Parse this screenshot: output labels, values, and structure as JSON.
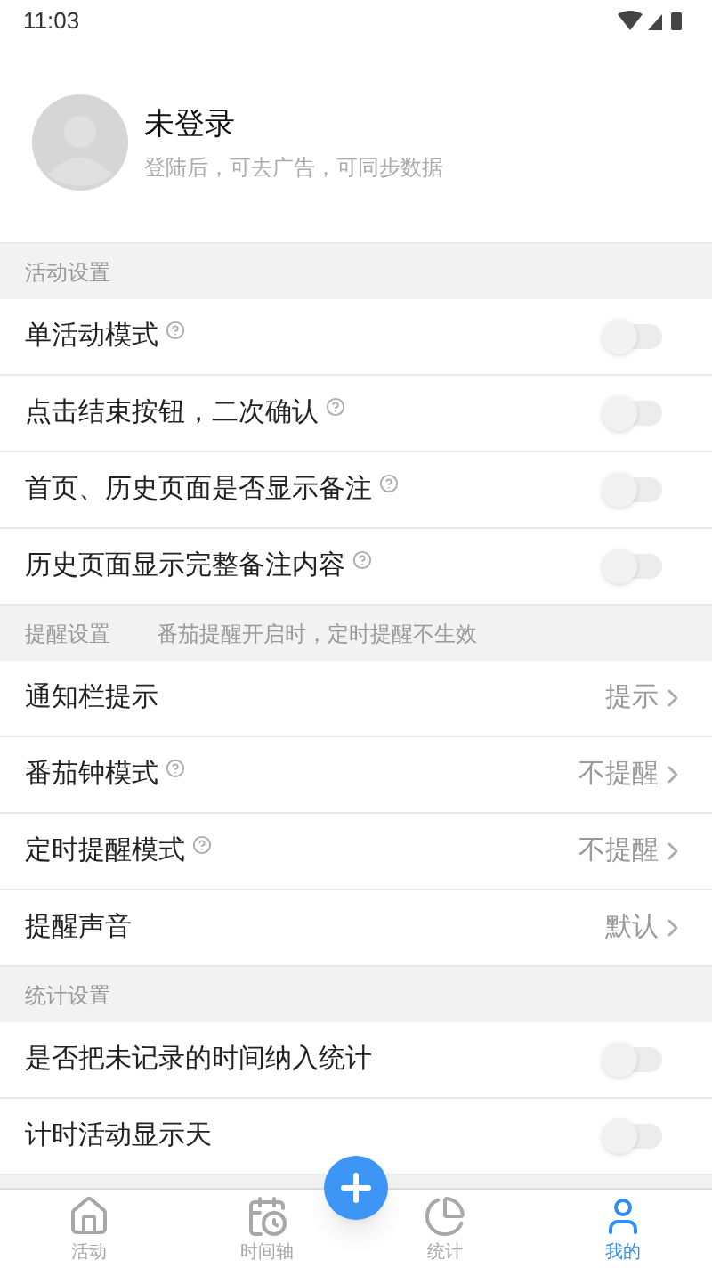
{
  "status_bar": {
    "time": "11:03"
  },
  "profile": {
    "name": "未登录",
    "subtitle": "登陆后，可去广告，可同步数据"
  },
  "sections": [
    {
      "title": "活动设置",
      "rows": [
        {
          "kind": "toggle",
          "label": "单活动模式",
          "help": true,
          "on": false
        },
        {
          "kind": "toggle",
          "label": "点击结束按钮，二次确认",
          "help": true,
          "on": false
        },
        {
          "kind": "toggle",
          "label": "首页、历史页面是否显示备注",
          "help": true,
          "on": false
        },
        {
          "kind": "toggle",
          "label": "历史页面显示完整备注内容",
          "help": true,
          "on": false
        }
      ]
    },
    {
      "title": "提醒设置",
      "note": "番茄提醒开启时，定时提醒不生效",
      "rows": [
        {
          "kind": "link",
          "label": "通知栏提示",
          "help": false,
          "value": "提示"
        },
        {
          "kind": "link",
          "label": "番茄钟模式",
          "help": true,
          "value": "不提醒"
        },
        {
          "kind": "link",
          "label": "定时提醒模式",
          "help": true,
          "value": "不提醒"
        },
        {
          "kind": "link",
          "label": "提醒声音",
          "help": false,
          "value": "默认"
        }
      ]
    },
    {
      "title": "统计设置",
      "rows": [
        {
          "kind": "toggle",
          "label": "是否把未记录的时间纳入统计",
          "help": false,
          "on": false
        },
        {
          "kind": "toggle",
          "label": "计时活动显示天",
          "help": false,
          "on": false
        }
      ]
    }
  ],
  "nav": [
    {
      "kind": "home",
      "label": "活动",
      "selected": false
    },
    {
      "kind": "clock",
      "label": "时间轴",
      "selected": false
    },
    {
      "kind": "pie",
      "label": "统计",
      "selected": false
    },
    {
      "kind": "user",
      "label": "我的",
      "selected": true
    }
  ]
}
